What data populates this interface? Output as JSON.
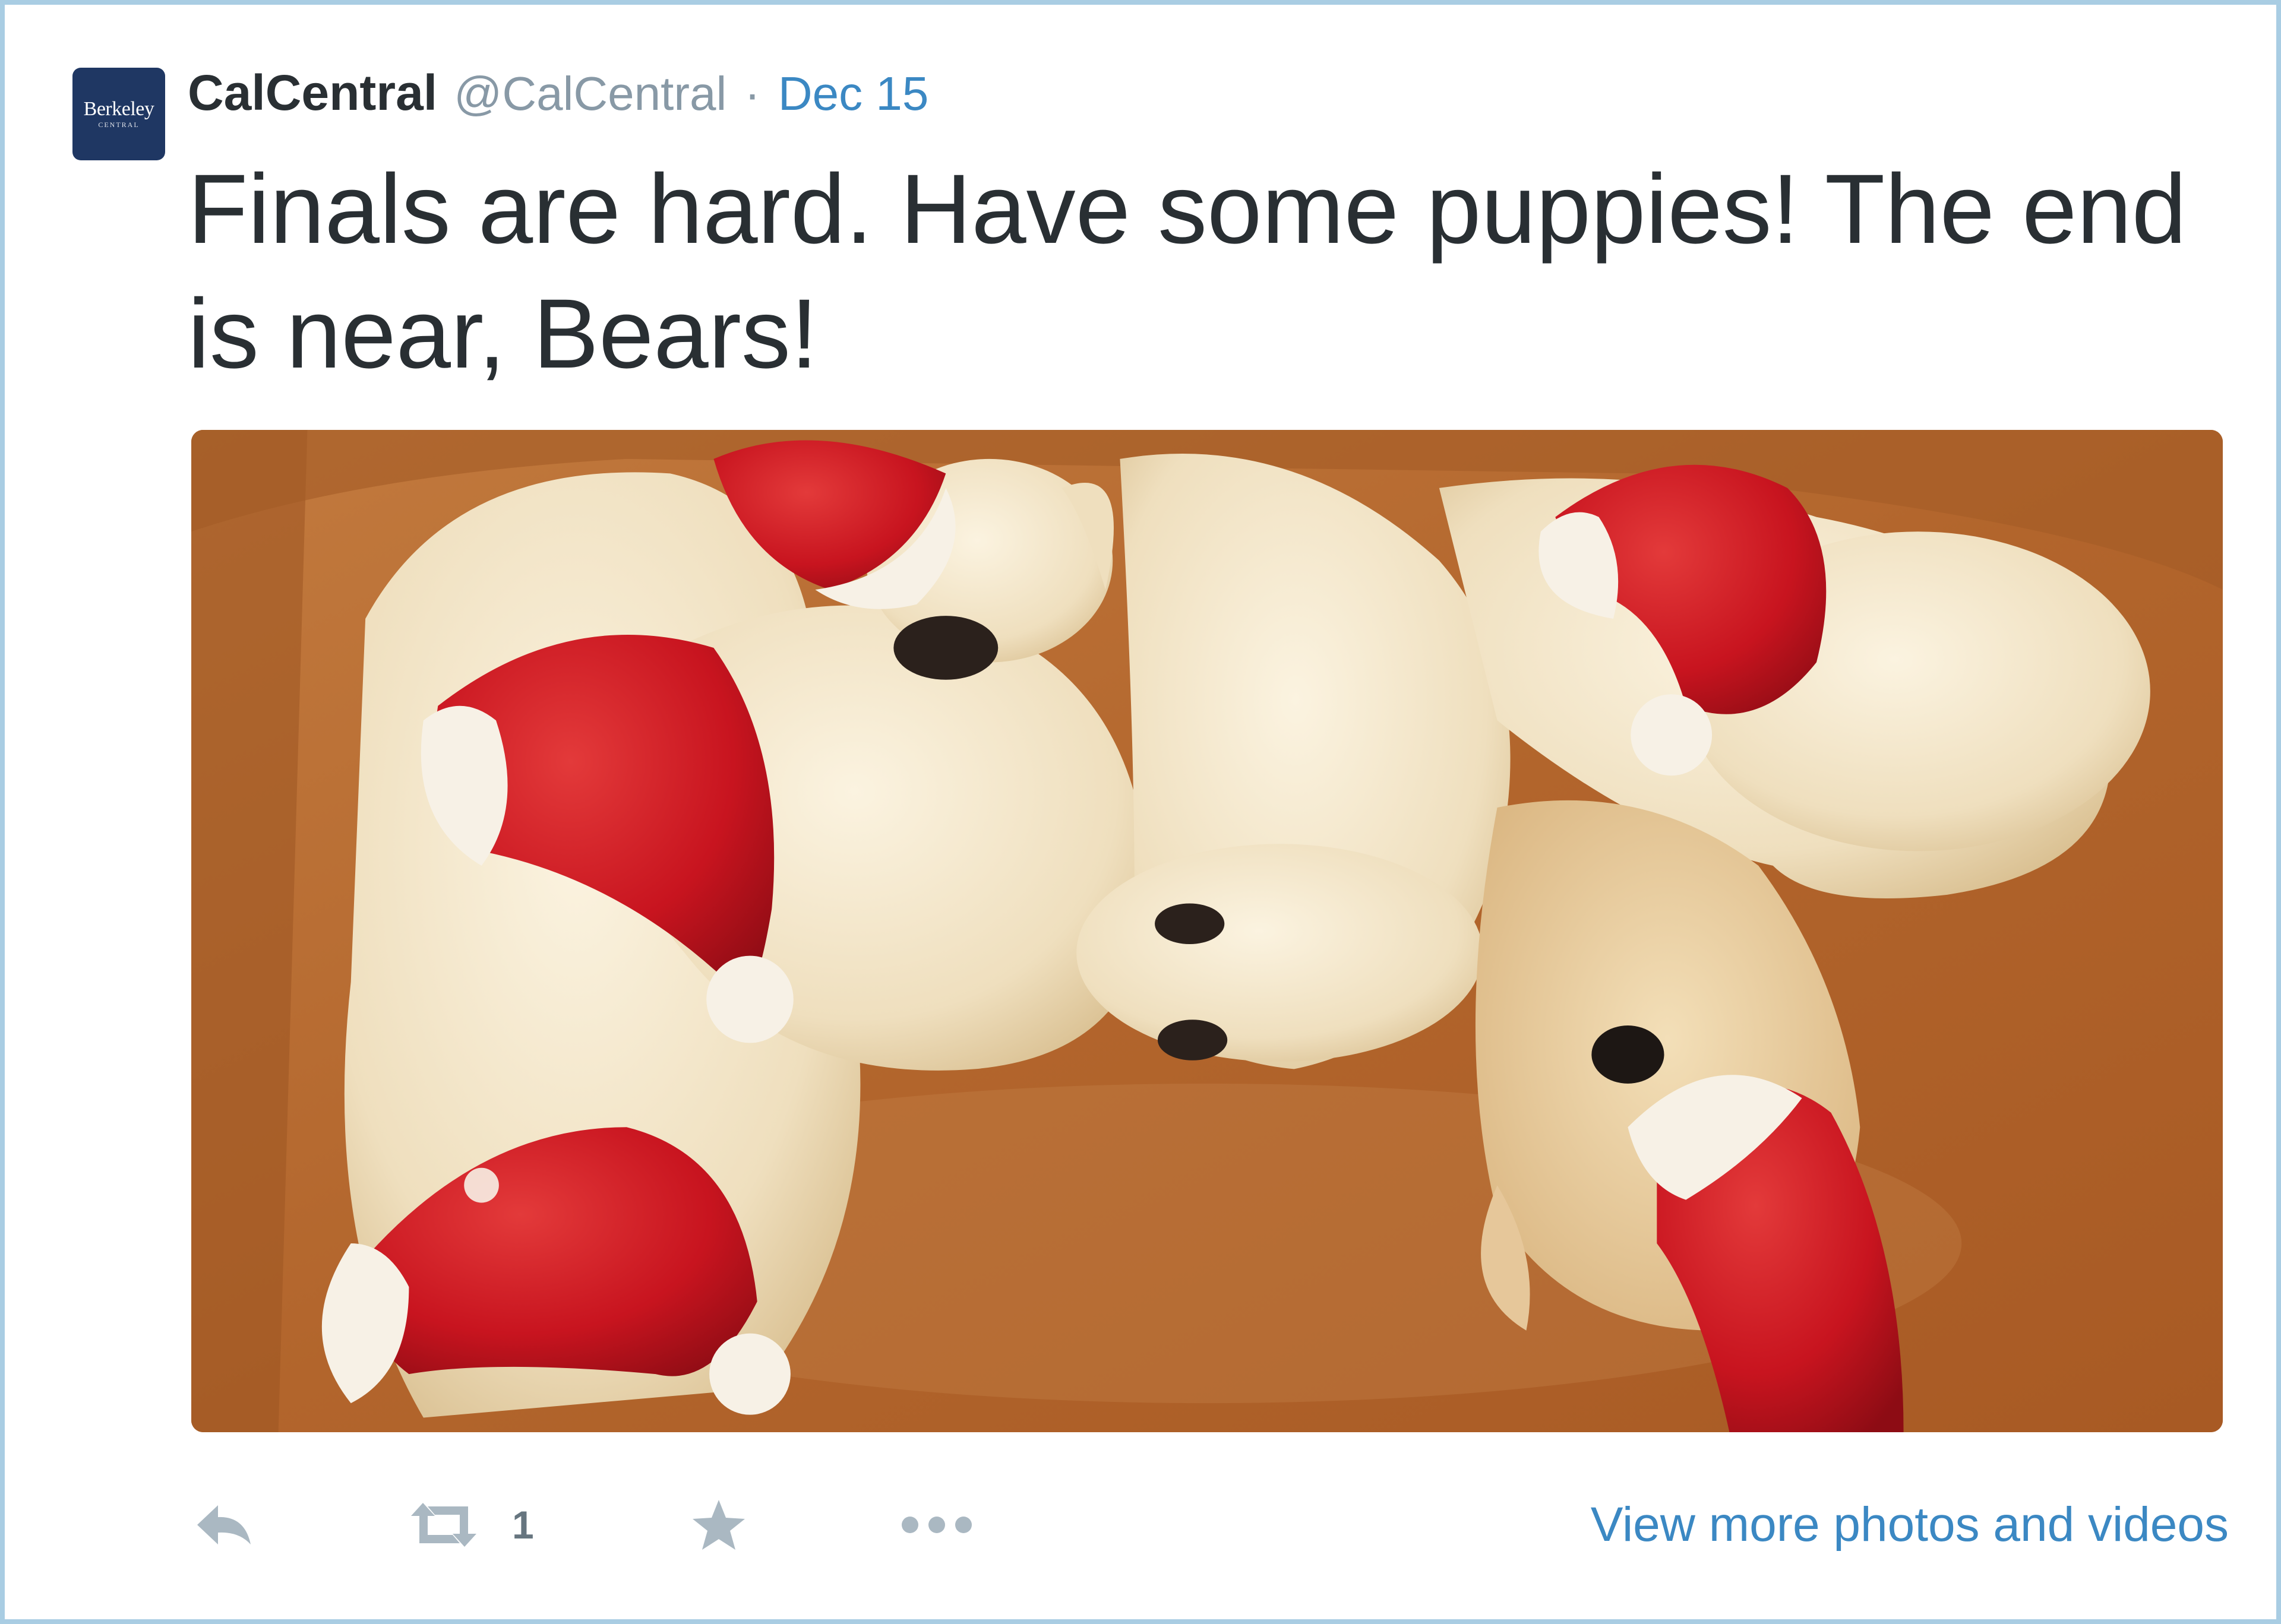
{
  "tweet": {
    "avatar": {
      "brand_line1": "Berkeley",
      "brand_line2": "CENTRAL",
      "background": "#1f3763"
    },
    "author_name": "CalCentral",
    "handle": "@CalCentral",
    "separator": "·",
    "date": "Dec 15",
    "text": "Finals are hard. Have some puppies! The end is near, Bears!",
    "photo": {
      "subject": "sleeping cream-colored puppies wearing red Santa hats on a brown leather couch"
    },
    "actions": {
      "reply_icon": "reply-icon",
      "retweet_icon": "retweet-icon",
      "retweet_count": "1",
      "favorite_icon": "star-icon",
      "more_icon": "more-dots-icon",
      "view_more_label": "View more photos and videos"
    }
  },
  "colors": {
    "border": "#a9cde3",
    "text": "#292f33",
    "muted": "#8899a6",
    "link": "#3b88c3",
    "action_icon": "#aab8c2"
  }
}
